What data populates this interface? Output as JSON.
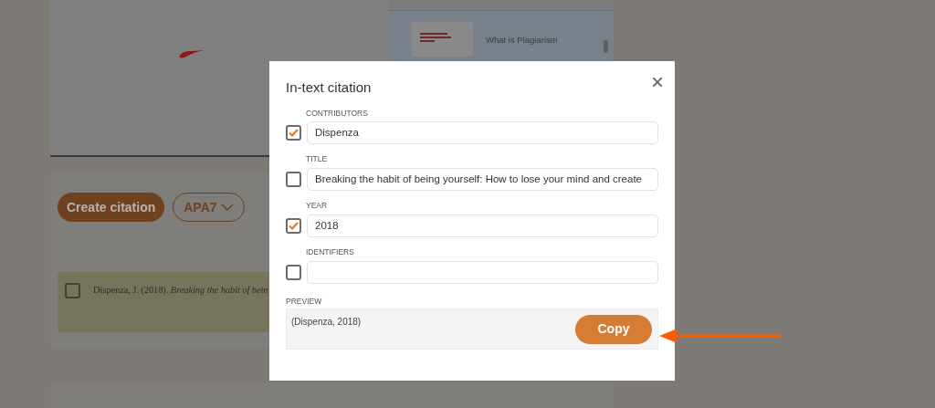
{
  "sidebar": {
    "items": [
      {
        "title": "What is Plagiarism"
      }
    ]
  },
  "citation_panel": {
    "create_button": "Create citation",
    "style_dropdown": "APA7",
    "citations": [
      {
        "text": "Dispenza, J. (2018). *Breaking the habit of bein*",
        "checked": false
      }
    ]
  },
  "dialog": {
    "title": "In-text citation",
    "close": "×",
    "fields": [
      {
        "label": "CONTRIBUTORS",
        "checked": true,
        "value": "Dispenza"
      },
      {
        "label": "TITLE",
        "checked": false,
        "value": "Breaking the habit of being yourself: How to lose your mind and create"
      },
      {
        "label": "YEAR",
        "checked": true,
        "value": "2018"
      },
      {
        "label": "IDENTIFIERS",
        "checked": false
      }
    ],
    "preview": {
      "label": "PREVIEW",
      "text": "(Dispenza, 2018)"
    },
    "copy_button": "Copy"
  }
}
